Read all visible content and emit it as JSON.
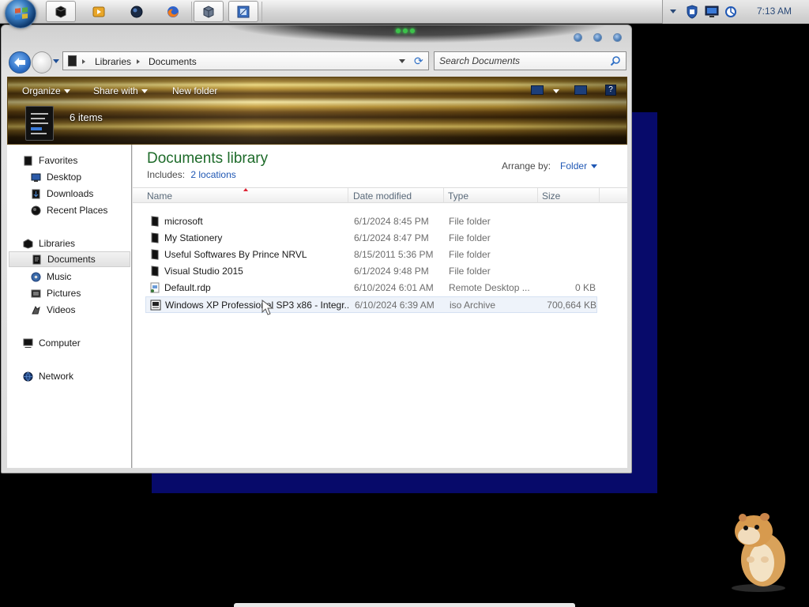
{
  "taskbar": {
    "start_label": "Start",
    "buttons": [
      {
        "icon": "explorer-icon",
        "active": true
      },
      {
        "icon": "media-player-icon",
        "active": false
      },
      {
        "icon": "orb-icon",
        "active": false
      },
      {
        "icon": "firefox-icon",
        "active": false
      },
      {
        "icon": "virtualbox-icon",
        "active": true
      },
      {
        "icon": "window-switch-icon",
        "active": true
      }
    ],
    "tray": {
      "icons": [
        "show-hidden-icons",
        "shield-icon",
        "monitor-icon",
        "network-icon"
      ],
      "clock": "7:13 AM"
    }
  },
  "window": {
    "address": {
      "crumbs": [
        "Libraries",
        "Documents"
      ]
    },
    "search": {
      "placeholder": "Search Documents"
    },
    "commands": {
      "organize": "Organize",
      "share_with": "Share with",
      "new_folder": "New folder"
    },
    "details": {
      "items_count": "6 items"
    },
    "navpane": {
      "favorites": {
        "label": "Favorites",
        "items": [
          "Desktop",
          "Downloads",
          "Recent Places"
        ]
      },
      "libraries": {
        "label": "Libraries",
        "items": [
          "Documents",
          "Music",
          "Pictures",
          "Videos"
        ],
        "selected": "Documents"
      },
      "computer": "Computer",
      "network": "Network"
    },
    "content": {
      "title": "Documents library",
      "includes_label": "Includes:",
      "includes_link": "2 locations",
      "arrange_label": "Arrange by:",
      "arrange_value": "Folder",
      "columns": [
        "Name",
        "Date modified",
        "Type",
        "Size"
      ],
      "files": [
        {
          "name": "microsoft",
          "date": "6/1/2024 8:45 PM",
          "type": "File folder",
          "size": "",
          "icon": "folder-icon"
        },
        {
          "name": "My Stationery",
          "date": "6/1/2024 8:47 PM",
          "type": "File folder",
          "size": "",
          "icon": "folder-icon"
        },
        {
          "name": "Useful Softwares By Prince NRVL",
          "date": "8/15/2011 5:36 PM",
          "type": "File folder",
          "size": "",
          "icon": "folder-icon"
        },
        {
          "name": "Visual Studio 2015",
          "date": "6/1/2024 9:48 PM",
          "type": "File folder",
          "size": "",
          "icon": "folder-icon"
        },
        {
          "name": "Default.rdp",
          "date": "6/10/2024 6:01 AM",
          "type": "Remote Desktop ...",
          "size": "0 KB",
          "icon": "rdp-file-icon"
        },
        {
          "name": "Windows XP Professional SP3 x86 - Integr...",
          "date": "6/10/2024 6:39 AM",
          "type": "iso Archive",
          "size": "700,664 KB",
          "icon": "iso-file-icon"
        }
      ]
    }
  }
}
